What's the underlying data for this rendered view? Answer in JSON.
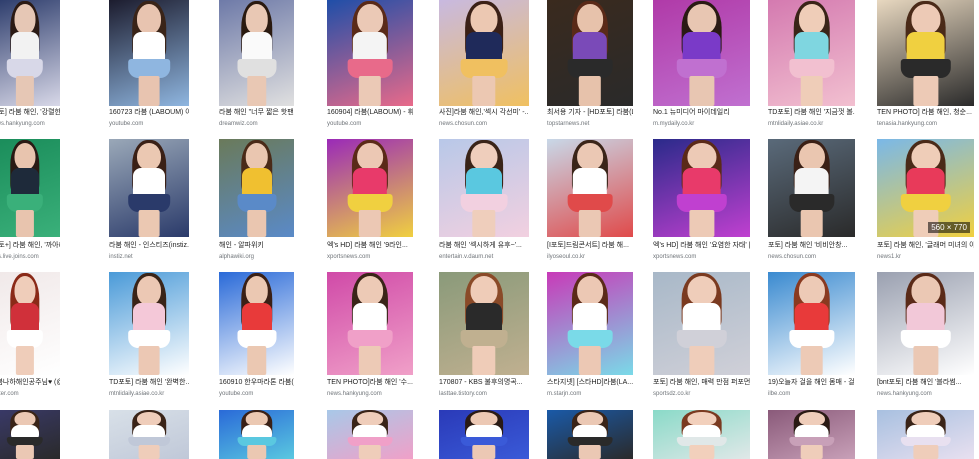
{
  "rows": [
    {
      "items": [
        {
          "title": "[포토] 라붐 해인, '강렬한 눈빛...",
          "source": "news.hankyung.com",
          "colors": [
            "#2a3a6a",
            "#e6c7b5",
            "#2b1a14",
            "#f2f2f2",
            "#d8d8e8"
          ]
        },
        {
          "title": "160723 라붐 (LABOUM) 아로...",
          "source": "youtube.com",
          "colors": [
            "#1c1c2e",
            "#e8c4b0",
            "#3a2418",
            "#ffffff",
            "#8fb6e0"
          ]
        },
        {
          "title": "라붐 해인 \"너무 짧은 핫팬츠\"",
          "source": "dreamwiz.com",
          "colors": [
            "#6e7aa8",
            "#e9c8b4",
            "#2a1a10",
            "#fafafa",
            "#e0e0e0"
          ]
        },
        {
          "title": "160904] 라붐(LABOUM) - 휘...",
          "source": "youtube.com",
          "colors": [
            "#1f4ea8",
            "#ebc9b6",
            "#5a2a18",
            "#f4f4f4",
            "#e86a8a"
          ]
        },
        {
          "title": "사진]라붐 해인,'섹시 각선미' -...",
          "source": "news.chosun.com",
          "colors": [
            "#c8b9e0",
            "#ecc8b2",
            "#3b2016",
            "#1f2a5a",
            "#f0c060"
          ]
        },
        {
          "title": "최서용 기자 - [HD포토] 라붐(L...",
          "source": "topstarnews.net",
          "colors": [
            "#3a2a1e",
            "#e7c2ab",
            "#5a2a18",
            "#7a4ab8",
            "#2a2a2a"
          ]
        },
        {
          "title": "No.1 뉴미디어 마이데일리",
          "source": "m.mydaily.co.kr",
          "colors": [
            "#b03aa8",
            "#e8c6b2",
            "#2a1a14",
            "#7a3ac8",
            "#c070d0"
          ]
        },
        {
          "title": "TD포토] 라붐 해인 '지금껏 볼...",
          "source": "mtnlidaily.asiae.co.kr",
          "colors": [
            "#d47ab0",
            "#efcdb8",
            "#3a2418",
            "#7fd6e0",
            "#f2c0d0"
          ]
        },
        {
          "title": "TEN PHOTO] 라붐 해인, 청순...",
          "source": "tenasia.hankyung.com",
          "colors": [
            "#e8d8c0",
            "#edcab6",
            "#4a2a18",
            "#f0d040",
            "#2a2a2a"
          ]
        }
      ]
    },
    {
      "items": [
        {
          "title": "[포토+] 라붐 해인, '까아라...",
          "source": "plus.live.joins.com",
          "colors": [
            "#1a8c5a",
            "#e8c4ae",
            "#2a1a14",
            "#1e2a3a",
            "#3ab07a"
          ]
        },
        {
          "title": "라붐 해인 - 인스티즈(instiz...",
          "source": "instiz.net",
          "colors": [
            "#9aa8b8",
            "#ebc8b2",
            "#3a2016",
            "#ffffff",
            "#2a3a6a"
          ]
        },
        {
          "title": "해인 - 알파위키",
          "source": "alphawiki.org",
          "colors": [
            "#6a7a5a",
            "#eac6b0",
            "#4a2a18",
            "#f0c030",
            "#5a8ac8"
          ]
        },
        {
          "title": "엑's HD] 라붐 해인 '9라인...",
          "source": "xportsnews.com",
          "colors": [
            "#9a2ab8",
            "#ecc8b4",
            "#5a2a18",
            "#e83a6a",
            "#f0d040"
          ]
        },
        {
          "title": "라붐 해인 '섹시하게 유후~'...",
          "source": "entertain.v.daum.net",
          "colors": [
            "#b8c8e8",
            "#efcebc",
            "#3a2418",
            "#5ac8e0",
            "#f2d0e0"
          ]
        },
        {
          "title": "[I포토]드림콘서트] 라붐 해...",
          "source": "ilyoseoul.co.kr",
          "colors": [
            "#c8d8e8",
            "#ebc8b4",
            "#3a2418",
            "#ffffff",
            "#e04a4a"
          ]
        },
        {
          "title": "엑's HD] 라붐 해인 '요염한 자태' |",
          "source": "xportsnews.com",
          "colors": [
            "#2a2a8a",
            "#edcab6",
            "#5a2a18",
            "#e83a6a",
            "#c040d0"
          ]
        },
        {
          "title": "포토] 라붐 해인 '비비안창...",
          "source": "news.chosun.com",
          "colors": [
            "#5a6a7a",
            "#eac6b0",
            "#3a2016",
            "#f4f4f4",
            "#2a2a2a"
          ]
        },
        {
          "title": "포토] 라붐 해인, '글래머 미녀의 아...",
          "source": "news1.kr",
          "colors": [
            "#7ab8e8",
            "#efcdb8",
            "#4a2a18",
            "#e83a5a",
            "#f0d040"
          ]
        }
      ]
    },
    {
      "items": [
        {
          "title": "라붐나하해인공주님♥ (@y_...",
          "source": "twitter.com",
          "colors": [
            "#f0e8e8",
            "#efcdba",
            "#8a2a18",
            "#d0303a",
            "#ffffff"
          ]
        },
        {
          "title": "TD포토] 라붐 해인 '완벽한...",
          "source": "mtnlidaily.asiae.co.kr",
          "colors": [
            "#4a9ad8",
            "#ecc8b4",
            "#3a2418",
            "#f4c8d8",
            "#ffffff"
          ]
        },
        {
          "title": "160910 한우마라톤 라붐(L...",
          "source": "youtube.com",
          "colors": [
            "#2a6ad8",
            "#ebc8b2",
            "#3a2016",
            "#e83a3a",
            "#ffffff"
          ]
        },
        {
          "title": "TEN PHOTO]라붐 해인 '수...",
          "source": "news.hankyung.com",
          "colors": [
            "#d04aa8",
            "#edcab6",
            "#3a2418",
            "#ffffff",
            "#f0a0c8"
          ]
        },
        {
          "title": "170807 - KBS 불후의명곡...",
          "source": "lasttae.tistory.com",
          "colors": [
            "#8a9a7a",
            "#efccb8",
            "#8a4a28",
            "#2a2a2a",
            "#c0b090"
          ]
        },
        {
          "title": "스타지넷] [스타HD]라붐(LA...",
          "source": "m.starjn.com",
          "colors": [
            "#c83ab8",
            "#ecc8b4",
            "#5a2a18",
            "#ffffff",
            "#7adae8"
          ]
        },
        {
          "title": "포토] 라붐 해인, 매력 만점 퍼포먼스~...",
          "source": "sportsdz.co.kr",
          "colors": [
            "#a8b8c8",
            "#efcdba",
            "#7a3a20",
            "#ffffff",
            "#d0d0d8"
          ]
        },
        {
          "title": "19)오늘자 걸을 해인 몸매 - 걸그룹, 연예인...",
          "source": "ilbe.com",
          "colors": [
            "#3a8ad0",
            "#edcab6",
            "#8a3a20",
            "#e83a3a",
            "#ffffff"
          ]
        },
        {
          "title": "[bnt포토] 라붐 해인 '블라썸...",
          "source": "news.hankyung.com",
          "colors": [
            "#9aa0b0",
            "#ebc8b4",
            "#5a2a18",
            "#f2c8d8",
            "#ffffff"
          ]
        }
      ]
    },
    {
      "items": [
        {
          "colors": [
            "#3a3a6a",
            "#ebc8b4",
            "#3a2418",
            "#ffffff",
            "#2a2a2a"
          ]
        },
        {
          "colors": [
            "#d8e0e8",
            "#efcdba",
            "#3a2418",
            "#ffffff",
            "#c0c8d8"
          ]
        },
        {
          "colors": [
            "#2a6ad8",
            "#ebc8b2",
            "#3a2016",
            "#ffffff",
            "#5ac8e0"
          ]
        },
        {
          "colors": [
            "#a8c8e8",
            "#efcdba",
            "#3a2418",
            "#ffffff",
            "#f0a0c8"
          ]
        },
        {
          "colors": [
            "#2a3ab8",
            "#ecc8b4",
            "#2a1a14",
            "#ffffff",
            "#3a5ad8"
          ]
        },
        {
          "colors": [
            "#1a5aa8",
            "#ebc8b4",
            "#3a2418",
            "#ffffff",
            "#2a2a2a"
          ]
        },
        {
          "colors": [
            "#8adac8",
            "#f2d0bc",
            "#7a3a20",
            "#ffffff",
            "#e0e8e8"
          ]
        },
        {
          "colors": [
            "#8a5a7a",
            "#efcdba",
            "#2a1a14",
            "#ffffff",
            "#c8a0b8"
          ]
        },
        {
          "colors": [
            "#a8c0e0",
            "#efcdba",
            "#3a2418",
            "#ffffff",
            "#e8e0f0"
          ]
        }
      ]
    }
  ],
  "badge": {
    "row": 1,
    "col": 8,
    "text": "560 × 770"
  }
}
